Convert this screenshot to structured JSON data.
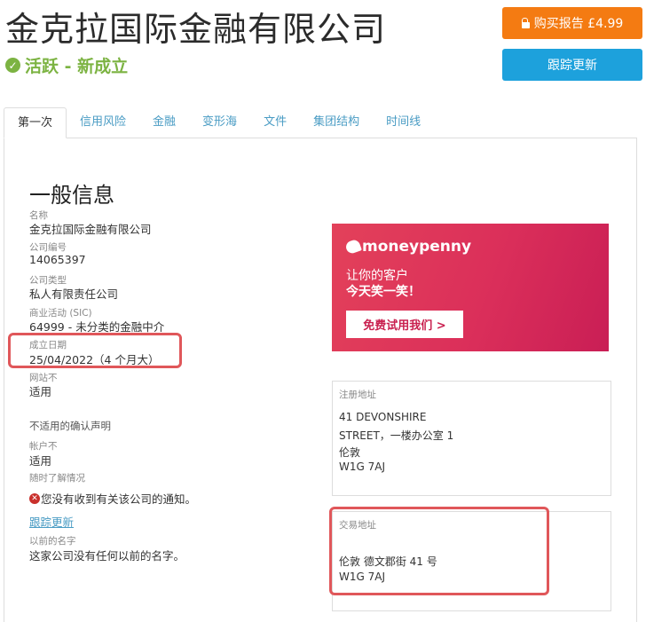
{
  "header": {
    "company_name": "金克拉国际金融有限公司",
    "status": "活跃 - 新成立",
    "buy_report_label": "购买报告 £4.99",
    "follow_label": "跟踪更新"
  },
  "tabs": [
    {
      "label": "第一次"
    },
    {
      "label": "信用风险"
    },
    {
      "label": "金融"
    },
    {
      "label": "变形海"
    },
    {
      "label": "文件"
    },
    {
      "label": "集团结构"
    },
    {
      "label": "时间线"
    }
  ],
  "general": {
    "title": "一般信息",
    "name_label": "名称",
    "name_value": "金克拉国际金融有限公司",
    "number_label": "公司编号",
    "number_value": "14065397",
    "type_label": "公司类型",
    "type_value": "私人有限责任公司",
    "sic_label": "商业活动 (SIC)",
    "sic_value": "64999 - 未分类的金融中介",
    "date_label": "成立日期",
    "date_value": "25/04/2022（4 个月大）",
    "website_label": "网站不",
    "website_value": "适用",
    "confirm_value": "不适用的确认声明",
    "accounts_label": "帐户不",
    "accounts_value": "适用",
    "updates_label": "随时了解情况",
    "notice_text": "您没有收到有关该公司的通知。",
    "follow_link": "跟踪更新",
    "previous_label": "以前的名字",
    "previous_value": "这家公司没有任何以前的名字。"
  },
  "ad": {
    "brand": "moneypenny",
    "line1": "让你的客户",
    "line2": "今天笑一笑！",
    "button": "免费试用我们 >"
  },
  "registered": {
    "label": "注册地址",
    "lines": [
      "41 DEVONSHIRE",
      "STREET，一楼办公室 1",
      "伦敦",
      "W1G 7AJ"
    ]
  },
  "trading": {
    "label": "交易地址",
    "lines": [
      "伦敦 德文郡街 41 号",
      "W1G 7AJ"
    ]
  },
  "colors": {
    "orange": "#f47b12",
    "blue": "#1da1dc",
    "green": "#7cb342",
    "highlight_red": "#e0575a",
    "ad_pink": "#db2f5a"
  }
}
